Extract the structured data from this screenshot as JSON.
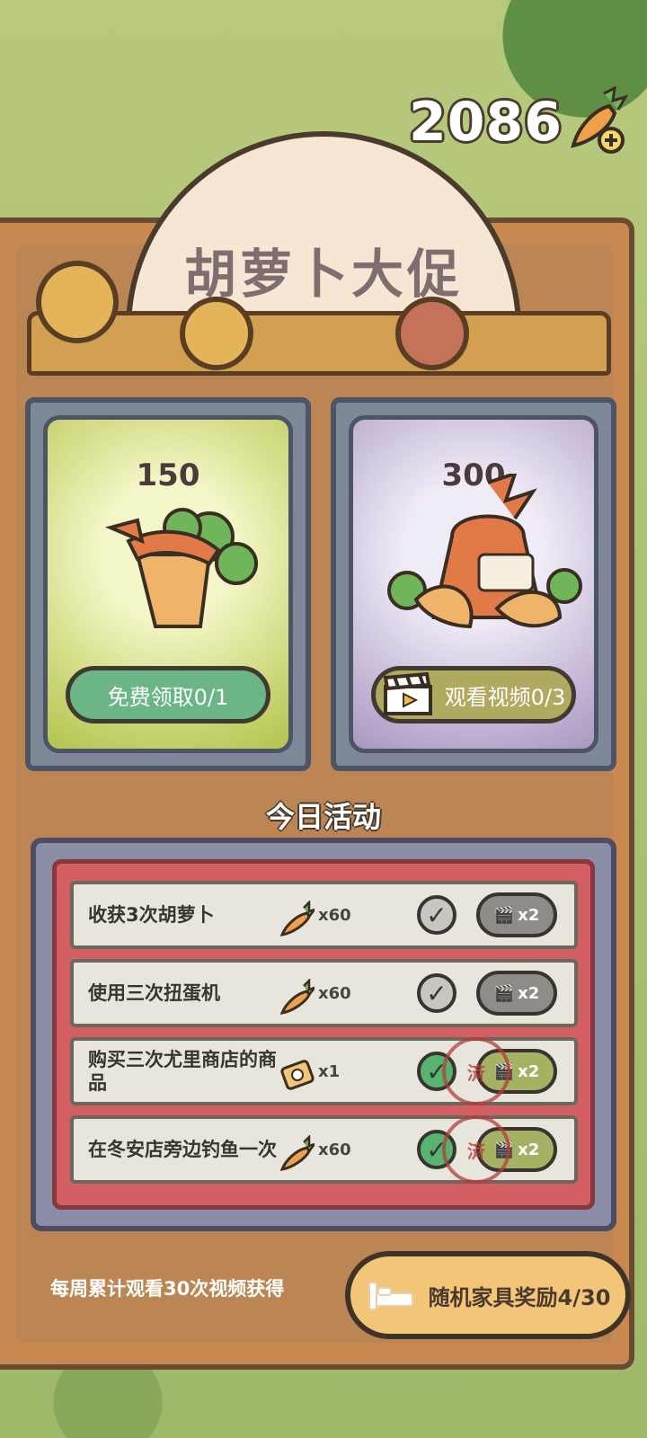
{
  "currency": {
    "amount": "2086"
  },
  "title": "胡萝卜大促",
  "cards": [
    {
      "amount": "150",
      "button_label": "免费领取0/1"
    },
    {
      "amount": "300",
      "button_label": "观看视频0/3"
    }
  ],
  "section_title": "今日活动",
  "tasks": [
    {
      "label": "收获3次胡萝卜",
      "reward_qty": "x60",
      "multiplier": "x2"
    },
    {
      "label": "使用三次扭蛋机",
      "reward_qty": "x60",
      "multiplier": "x2"
    },
    {
      "label": "购买三次尤里商店的商品",
      "reward_qty": "x1",
      "multiplier": "x2",
      "stamp": "済"
    },
    {
      "label": "在冬安店旁边钓鱼一次",
      "reward_qty": "x60",
      "multiplier": "x2",
      "stamp": "済"
    }
  ],
  "weekly": {
    "text": "每周累计观看30次视频获得",
    "button_label": "随机家具奖励4/30"
  },
  "colors": {
    "accent_green": "#6bb586",
    "accent_olive": "#b1a95f",
    "panel": "#c9884f",
    "task_bg": "#d35f62"
  }
}
